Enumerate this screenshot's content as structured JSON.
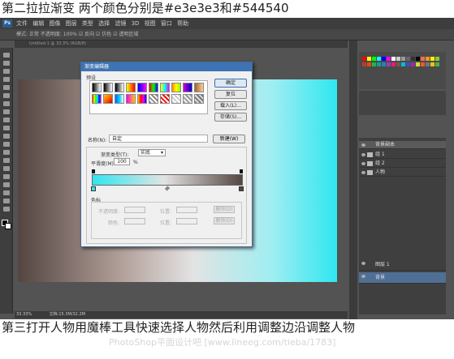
{
  "captions": {
    "top": "第二拉拉渐变 两个颜色分别是#e3e3e3和#544540",
    "bottom": "第三打开人物用魔棒工具快速选择人物然后利用调整边沿调整人物",
    "watermark": "PhotoShop平面设计吧 [www.lineeg.com/tieba/1783]"
  },
  "app": {
    "logo": "Ps",
    "menu_items": "文件 编辑 图像 图层 类型 选择 滤镜 3D 视图 窗口 帮助",
    "options_text": "模式: 正常   不透明度: 100%   ☑ 反向 ☑ 仿色 ☑ 透明区域",
    "doc_tab": "Untitled-1 @ 33.3% (RGB/8)",
    "status_zoom": "33.33%",
    "status_doc": "文档:15.3M/32.2M"
  },
  "dialog": {
    "title": "渐变编辑器",
    "presets_label": "预设",
    "buttons": {
      "ok": "确定",
      "reset": "复位",
      "load": "载入(L)...",
      "save": "存储(S)..."
    },
    "name_label": "名称(N):",
    "name_value": "自定",
    "new_button": "新建(W)",
    "type_label": "渐变类型(T):",
    "type_value": "实底",
    "smoothness_label": "平滑度(M):",
    "smoothness_value": "100",
    "smoothness_unit": "%",
    "stops_label": "色标",
    "stop_opacity_label": "不透明度:",
    "stop_location_label": "位置:",
    "stop_color_label": "颜色:",
    "delete_label": "删除(D)"
  },
  "colors": {
    "start": "#2ee6f0",
    "mid": "#e3e3e3",
    "end": "#544540"
  },
  "layers": {
    "rows": [
      "背景副本",
      "组 1",
      "组 2",
      "人物",
      "图层 1",
      "背景"
    ]
  }
}
